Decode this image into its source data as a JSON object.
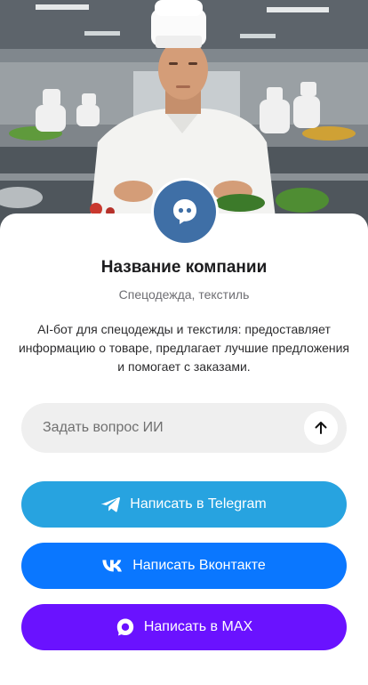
{
  "company": {
    "name": "Название компании",
    "category": "Спецодежда, текстиль",
    "description": "AI-бот для спецодежды и текстиля: предоставляет информацию о товаре, предлагает лучшие предложения и помогает с заказами."
  },
  "ask": {
    "placeholder": "Задать вопрос ИИ",
    "send_icon": "arrow-up-icon"
  },
  "buttons": [
    {
      "label": "Написать в Telegram",
      "icon": "telegram-icon",
      "color": "#27a3e0"
    },
    {
      "label": "Написать Вконтакте",
      "icon": "vk-icon",
      "color": "#0a77ff"
    },
    {
      "label": "Написать в MAX",
      "icon": "max-icon",
      "color": "#6a12ff"
    }
  ],
  "avatar": {
    "icon": "chat-bot-icon",
    "color": "#3f6fa6"
  }
}
